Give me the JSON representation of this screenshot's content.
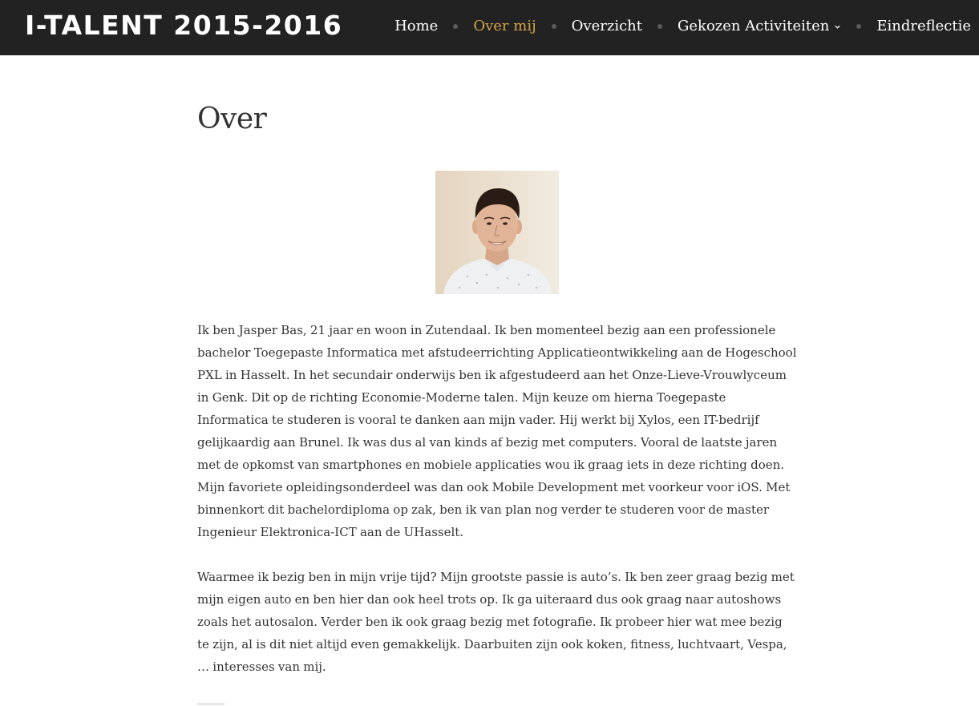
{
  "site": {
    "title": "I-TALENT 2015-2016"
  },
  "nav": {
    "items": [
      {
        "label": "Home"
      },
      {
        "label": "Over mij"
      },
      {
        "label": "Overzicht"
      },
      {
        "label": "Gekozen Activiteiten"
      },
      {
        "label": "Eindreflectie"
      }
    ],
    "active_label": "Over mij",
    "dropdown_icon": "chevron-down-icon"
  },
  "page": {
    "heading": "Over",
    "photo_icon": "portrait-photo",
    "paragraphs": [
      "Ik ben Jasper Bas, 21 jaar en woon in Zutendaal. Ik ben momenteel bezig aan een professionele bachelor Toegepaste Informatica met afstudeerrichting Applicatieontwikkeling aan de Hogeschool PXL in Hasselt. In het secundair onderwijs ben ik afgestudeerd aan het Onze-Lieve-Vrouwlyceum in Genk. Dit op de richting Economie-Moderne talen. Mijn keuze om hierna Toegepaste Informatica te studeren is vooral te danken aan mijn vader. Hij werkt bij Xylos, een IT-bedrijf gelijkaardig aan Brunel. Ik was dus al van kinds af bezig met computers. Vooral de laatste jaren met de opkomst van smartphones en mobiele applicaties wou ik graag iets in deze richting doen. Mijn favoriete opleidingsonderdeel was dan ook Mobile Development met voorkeur voor iOS. Met binnenkort dit bachelordiploma op zak, ben ik van plan nog verder te studeren voor de master Ingenieur Elektronica-ICT aan de UHasselt.",
      "Waarmee ik bezig ben in mijn vrije tijd? Mijn grootste passie is auto’s. Ik ben zeer graag bezig met mijn eigen auto en ben hier dan ook heel trots op. Ik ga uiteraard dus ook graag naar autoshows zoals het autosalon. Verder ben ik ook graag bezig met fotografie. Ik probeer hier wat mee bezig te zijn, al is dit niet altijd even gemakkelijk. Daarbuiten zijn ook koken, fitness, luchtvaart, Vespa, … interesses van mij."
    ]
  },
  "colors": {
    "header_bg": "#222222",
    "nav_text": "#ffffff",
    "nav_active": "#d8a54a",
    "body_text": "#333333",
    "page_bg": "#ffffff"
  }
}
